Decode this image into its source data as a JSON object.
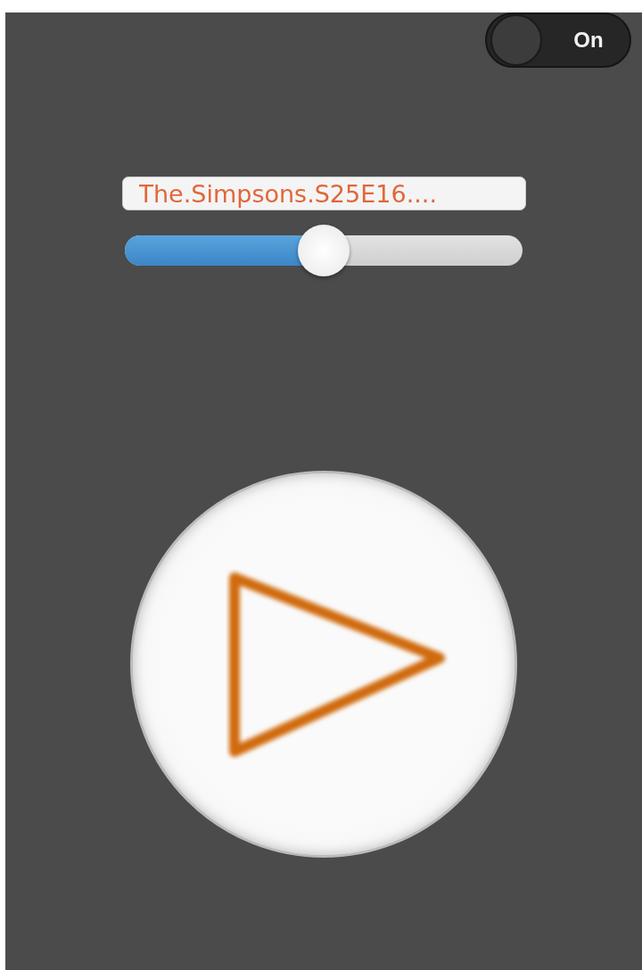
{
  "toggle": {
    "label": "On",
    "on": true
  },
  "title_field": {
    "value": "The.Simpsons.S25E16...."
  },
  "seek_slider": {
    "level": 0.5
  },
  "play_button": {
    "playing": false
  }
}
